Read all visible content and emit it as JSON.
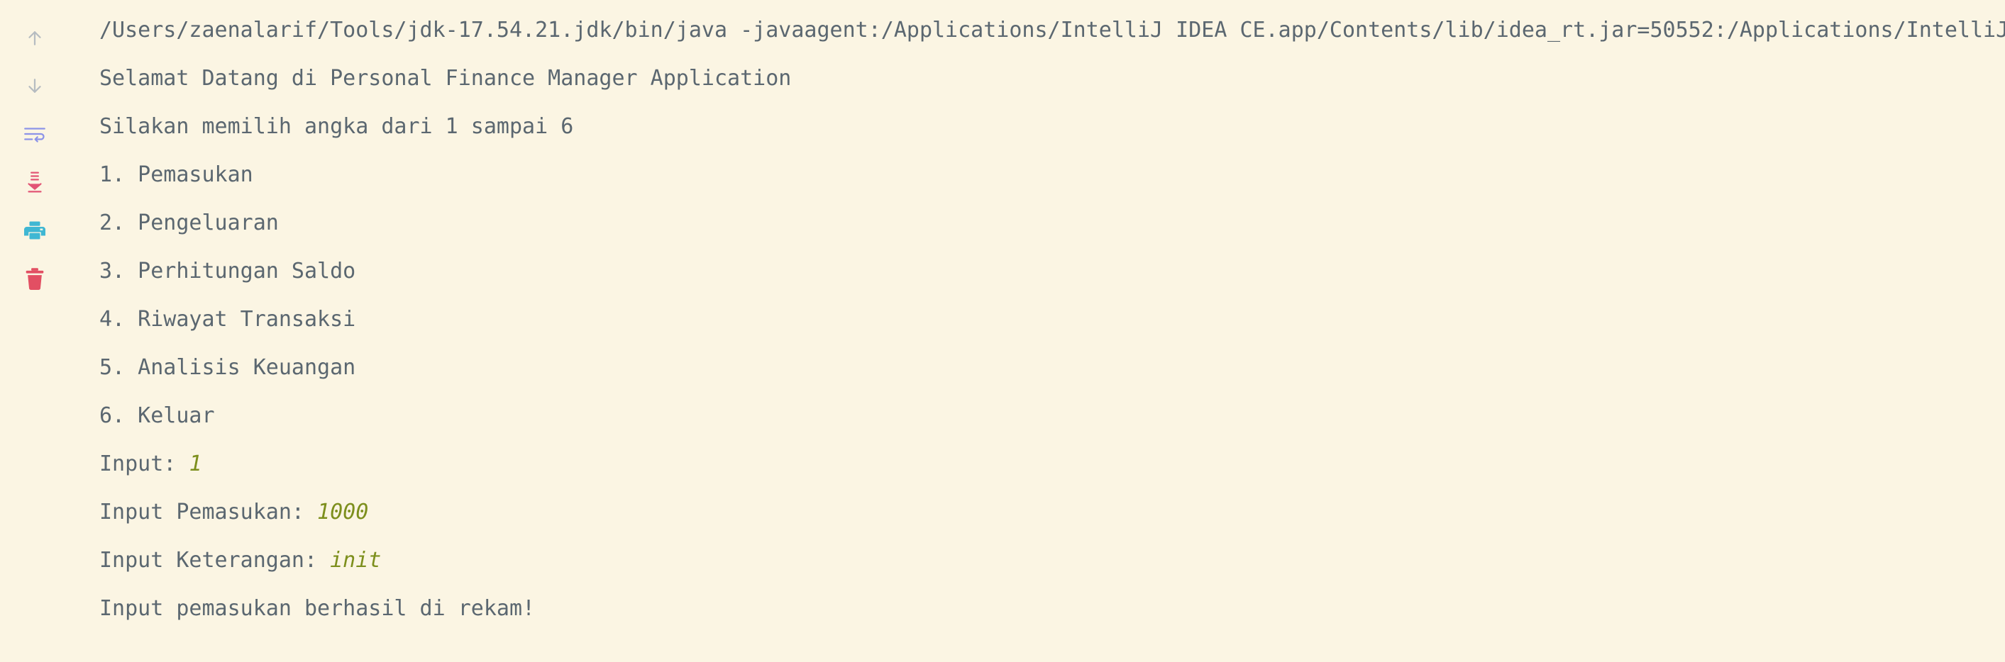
{
  "toolbar": {
    "icons": [
      {
        "name": "scroll-up-icon",
        "color": "#b6bcc1"
      },
      {
        "name": "scroll-down-icon",
        "color": "#b6bcc1"
      },
      {
        "name": "soft-wrap-icon",
        "color": "#8c93e8"
      },
      {
        "name": "scroll-to-end-icon",
        "color": "#e25575"
      },
      {
        "name": "print-icon",
        "color": "#3fb7d3"
      },
      {
        "name": "clear-all-icon",
        "color": "#e24f63"
      }
    ]
  },
  "console": {
    "command": "/Users/zaenalarif/Tools/jdk-17.54.21.jdk/bin/java -javaagent:/Applications/IntelliJ IDEA CE.app/Contents/lib/idea_rt.jar=50552:/Applications/IntelliJ",
    "welcome": "Selamat Datang di Personal Finance Manager Application",
    "prompt": "Silakan memilih angka dari 1 sampai 6",
    "menu": [
      "1. Pemasukan",
      "2. Pengeluaran",
      "3. Perhitungan Saldo",
      "4. Riwayat Transaksi",
      "5. Analisis Keuangan",
      "6. Keluar"
    ],
    "input_label": "Input: ",
    "input_value": "1",
    "income_label": "Input Pemasukan: ",
    "income_value": "1000",
    "description_label": "Input Keterangan: ",
    "description_value": "init",
    "result": "Input pemasukan berhasil di rekam!"
  },
  "colors": {
    "background": "#fbf5e3",
    "text": "#5b6770",
    "user_input": "#7d8f1d"
  }
}
